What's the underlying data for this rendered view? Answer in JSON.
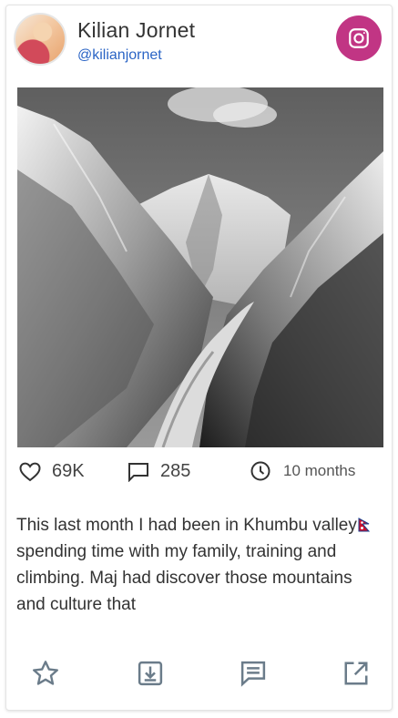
{
  "profile": {
    "name": "Kilian Jornet",
    "handle": "@kilianjornet"
  },
  "network": {
    "icon": "instagram-icon",
    "color": "#c13584"
  },
  "post": {
    "image_icon": "mountain-photo",
    "likes": "69K",
    "comments": "285",
    "time_ago": "10 months",
    "caption_part1": "This last month I had been in Khumbu valley",
    "caption_flag": "nepal-flag-icon",
    "caption_part2": " spending time with my family, training and climbing. Maj had discover those mountains and culture that"
  },
  "actions": [
    {
      "icon": "star-icon"
    },
    {
      "icon": "download-icon"
    },
    {
      "icon": "comment-icon"
    },
    {
      "icon": "external-link-icon"
    }
  ],
  "colors": {
    "handle": "#2a64c5",
    "icon_gray": "#6b7c8a",
    "text": "#333333"
  }
}
